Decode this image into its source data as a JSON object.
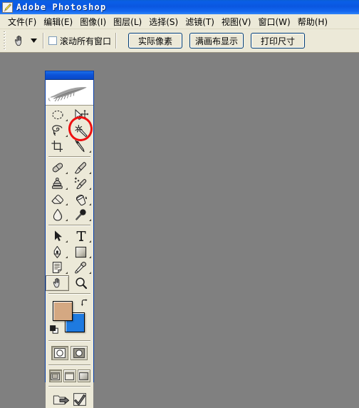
{
  "window": {
    "title": "Adobe Photoshop",
    "app_icon": "photoshop-feather-icon",
    "titlebar_color": "#0a57e0"
  },
  "menubar": {
    "items": [
      {
        "label": "文件(F)",
        "name": "menu-file"
      },
      {
        "label": "编辑(E)",
        "name": "menu-edit"
      },
      {
        "label": "图像(I)",
        "name": "menu-image"
      },
      {
        "label": "图层(L)",
        "name": "menu-layer"
      },
      {
        "label": "选择(S)",
        "name": "menu-select"
      },
      {
        "label": "滤镜(T)",
        "name": "menu-filter"
      },
      {
        "label": "视图(V)",
        "name": "menu-view"
      },
      {
        "label": "窗口(W)",
        "name": "menu-window"
      },
      {
        "label": "帮助(H)",
        "name": "menu-help"
      }
    ]
  },
  "options_bar": {
    "active_tool_icon": "hand-tool-icon",
    "preset_dropdown_icon": "chevron-down-icon",
    "scroll_all_windows": {
      "label": "滚动所有窗口",
      "checked": false
    },
    "buttons": [
      {
        "label": "实际像素",
        "name": "actual-pixels-button"
      },
      {
        "label": "满画布显示",
        "name": "fit-on-screen-button"
      },
      {
        "label": "打印尺寸",
        "name": "print-size-button"
      }
    ]
  },
  "toolbox": {
    "logo_icon": "photoshop-feather-logo",
    "selected_tool": "hand-tool",
    "rows": [
      [
        {
          "name": "elliptical-marquee-tool",
          "icon": "ellipse-marquee-icon",
          "has_flyout": true,
          "selected": false
        },
        {
          "name": "move-tool",
          "icon": "move-arrow-icon",
          "has_flyout": false,
          "selected": false
        }
      ],
      [
        {
          "name": "lasso-tool",
          "icon": "lasso-icon",
          "has_flyout": true,
          "selected": false
        },
        {
          "name": "magic-wand-tool",
          "icon": "magic-wand-icon",
          "has_flyout": false,
          "selected": false
        }
      ],
      [
        {
          "name": "crop-tool",
          "icon": "crop-icon",
          "has_flyout": false,
          "selected": false
        },
        {
          "name": "slice-tool",
          "icon": "slice-knife-icon",
          "has_flyout": true,
          "selected": false
        }
      ],
      [
        {
          "name": "healing-brush-tool",
          "icon": "healing-bandage-icon",
          "has_flyout": true,
          "selected": false
        },
        {
          "name": "brush-tool",
          "icon": "paintbrush-icon",
          "has_flyout": true,
          "selected": false
        }
      ],
      [
        {
          "name": "clone-stamp-tool",
          "icon": "clone-stamp-icon",
          "has_flyout": true,
          "selected": false
        },
        {
          "name": "history-brush-tool",
          "icon": "history-brush-icon",
          "has_flyout": true,
          "selected": false
        }
      ],
      [
        {
          "name": "eraser-tool",
          "icon": "eraser-icon",
          "has_flyout": true,
          "selected": false
        },
        {
          "name": "paint-bucket-tool",
          "icon": "paint-bucket-icon",
          "has_flyout": true,
          "selected": false
        }
      ],
      [
        {
          "name": "blur-tool",
          "icon": "waterdrop-icon",
          "has_flyout": true,
          "selected": false
        },
        {
          "name": "dodge-tool",
          "icon": "dodge-lollipop-icon",
          "has_flyout": true,
          "selected": false
        }
      ],
      [
        {
          "name": "path-selection-tool",
          "icon": "black-arrow-icon",
          "has_flyout": true,
          "selected": false
        },
        {
          "name": "type-tool",
          "icon": "text-t-icon",
          "has_flyout": true,
          "selected": false
        }
      ],
      [
        {
          "name": "pen-tool",
          "icon": "pen-nib-icon",
          "has_flyout": true,
          "selected": false
        },
        {
          "name": "rectangle-shape-tool",
          "icon": "rectangle-shape-icon",
          "has_flyout": true,
          "selected": false
        }
      ],
      [
        {
          "name": "notes-tool",
          "icon": "notes-page-icon",
          "has_flyout": true,
          "selected": false
        },
        {
          "name": "eyedropper-tool",
          "icon": "eyedropper-icon",
          "has_flyout": true,
          "selected": false
        }
      ],
      [
        {
          "name": "hand-tool",
          "icon": "hand-tool-icon",
          "has_flyout": false,
          "selected": true
        },
        {
          "name": "zoom-tool",
          "icon": "magnifier-icon",
          "has_flyout": false,
          "selected": false
        }
      ]
    ],
    "colors": {
      "foreground": "#d4a882",
      "background": "#1e7ae0",
      "swap_icon": "swap-colors-icon",
      "default_icon": "default-colors-icon"
    },
    "quick_mask": [
      {
        "name": "standard-mode-button",
        "icon": "standard-mode-icon",
        "active": true
      },
      {
        "name": "quick-mask-mode-button",
        "icon": "quick-mask-icon",
        "active": false
      }
    ],
    "screen_modes": [
      {
        "name": "standard-screen-mode-button",
        "icon": "standard-screen-icon",
        "active": true
      },
      {
        "name": "full-screen-menubar-mode-button",
        "icon": "full-screen-menubar-icon",
        "active": false
      },
      {
        "name": "full-screen-mode-button",
        "icon": "full-screen-icon",
        "active": false
      }
    ],
    "jump_to": [
      {
        "name": "jump-to-imageready-button",
        "icon": "jump-to-icon"
      },
      {
        "name": "imageready-check-button",
        "icon": "imageready-check-icon"
      }
    ]
  },
  "annotation": {
    "name": "red-circle-highlight",
    "target_tool": "magic-wand-tool",
    "color": "#ee1111",
    "shape": "ellipse"
  },
  "canvas": {
    "background_color": "#808080"
  }
}
